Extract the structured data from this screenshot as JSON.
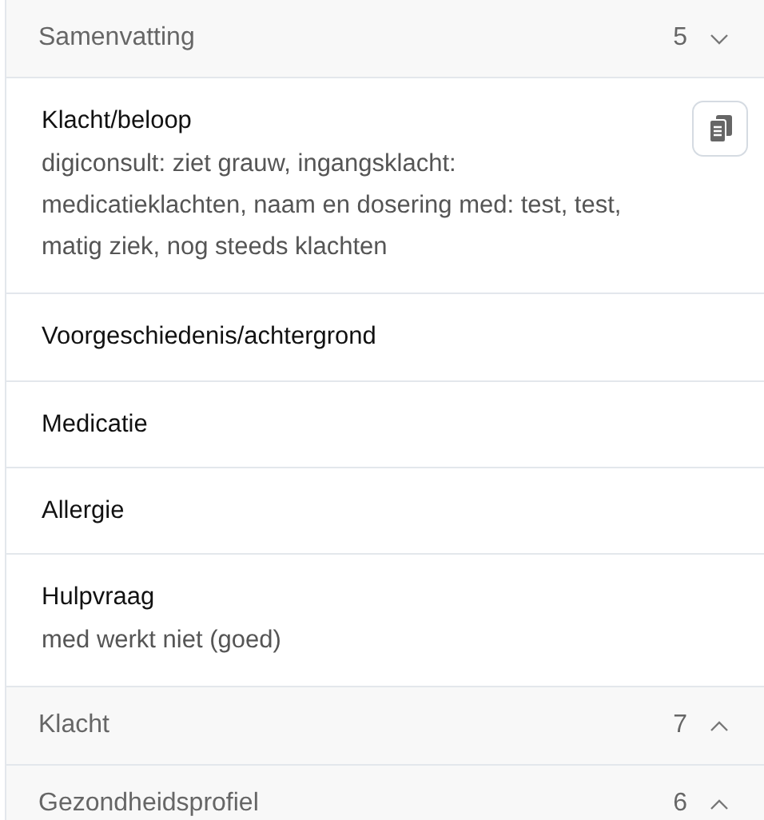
{
  "sections": [
    {
      "title": "Samenvatting",
      "count": "5",
      "expanded": true,
      "items": [
        {
          "title": "Klacht/beloop",
          "text": "digiconsult: ziet grauw, ingangsklacht: medicatieklachten, naam en dosering med: test, test, matig ziek, nog steeds klachten",
          "copyable": true
        },
        {
          "title": "Voorgeschiedenis/achtergrond",
          "copyable": false
        },
        {
          "title": "Medicatie",
          "copyable": false
        },
        {
          "title": "Allergie",
          "copyable": false
        },
        {
          "title": "Hulpvraag",
          "text": "med werkt niet (goed)",
          "copyable": false
        }
      ]
    },
    {
      "title": "Klacht",
      "count": "7",
      "expanded": false
    },
    {
      "title": "Gezondheidsprofiel",
      "count": "6",
      "expanded": false
    }
  ]
}
